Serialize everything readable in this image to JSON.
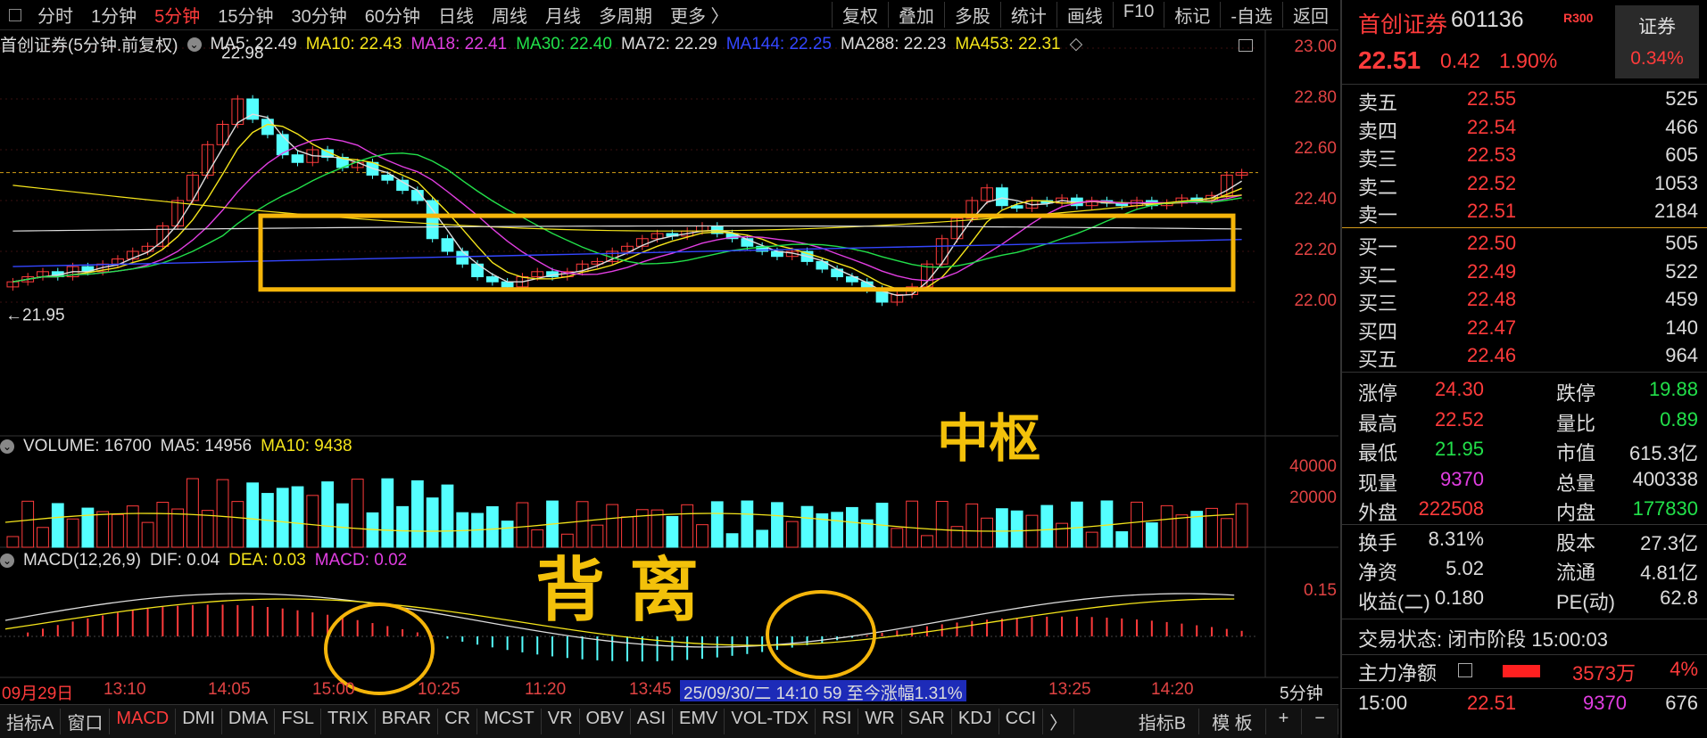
{
  "toolbar": {
    "periods": [
      "分时",
      "1分钟",
      "5分钟",
      "15分钟",
      "30分钟",
      "60分钟",
      "日线",
      "周线",
      "月线",
      "多周期",
      "更多 〉"
    ],
    "active_period": "5分钟",
    "tools": [
      "复权",
      "叠加",
      "多股",
      "统计",
      "画线",
      "F10",
      "标记",
      "-自选",
      "返回"
    ]
  },
  "main_legend": {
    "title": "首创证券(5分钟.前复权)",
    "items": [
      {
        "label": "MA5: 22.49",
        "color": "#dddddd"
      },
      {
        "label": "MA10: 22.43",
        "color": "#f5e51b"
      },
      {
        "label": "MA18: 22.41",
        "color": "#e13ee1"
      },
      {
        "label": "MA30: 22.40",
        "color": "#22e04a"
      },
      {
        "label": "MA72: 22.29",
        "color": "#dddddd"
      },
      {
        "label": "MA144: 22.25",
        "color": "#3446ff"
      },
      {
        "label": "MA288: 22.23",
        "color": "#dddddd"
      },
      {
        "label": "MA453: 22.31",
        "color": "#f5e51b"
      }
    ]
  },
  "price_axis": [
    "23.00",
    "22.80",
    "22.60",
    "22.40",
    "22.20",
    "22.00"
  ],
  "high_label": "22.98",
  "low_label": "21.95",
  "volume_legend": {
    "title": "VOLUME: 16700",
    "ma5": "MA5: 14956",
    "ma10": "MA10: 9438"
  },
  "volume_axis": [
    "40000",
    "20000"
  ],
  "macd_legend": {
    "title": "MACD(12,26,9)",
    "dif": "DIF: 0.04",
    "dea": "DEA: 0.03",
    "macd": "MACD: 0.02"
  },
  "macd_axis": [
    "0.15"
  ],
  "time_axis": [
    "09月29日",
    "13:10",
    "14:05",
    "15:00",
    "10:25",
    "11:20",
    "13:45",
    "13:25",
    "14:20"
  ],
  "time_highlight": "25/09/30/二 14:10 59 至今涨幅1.31%",
  "period_label": "5分钟",
  "annotations": {
    "zhongshu": "中枢",
    "beili": "背 离"
  },
  "tabs": [
    "指标A",
    "窗口",
    "MACD",
    "DMI",
    "DMA",
    "FSL",
    "TRIX",
    "BRAR",
    "CR",
    "MCST",
    "VR",
    "OBV",
    "ASI",
    "EMV",
    "VOL-TDX",
    "RSI",
    "WR",
    "SAR",
    "KDJ",
    "CCI",
    "〉"
  ],
  "active_tab": "MACD",
  "tabs_right": [
    "指标B",
    "模 板",
    "+",
    "−"
  ],
  "panel": {
    "name": "首创证券",
    "code": "601136",
    "badge": "R300",
    "sector": "证券",
    "sector_change": "0.34%",
    "price": "22.51",
    "change": "0.42",
    "change_pct": "1.90%",
    "asks": [
      {
        "label": "卖五",
        "price": "22.55",
        "vol": "525"
      },
      {
        "label": "卖四",
        "price": "22.54",
        "vol": "466"
      },
      {
        "label": "卖三",
        "price": "22.53",
        "vol": "605"
      },
      {
        "label": "卖二",
        "price": "22.52",
        "vol": "1053"
      },
      {
        "label": "卖一",
        "price": "22.51",
        "vol": "2184"
      }
    ],
    "bids": [
      {
        "label": "买一",
        "price": "22.50",
        "vol": "505"
      },
      {
        "label": "买二",
        "price": "22.49",
        "vol": "522"
      },
      {
        "label": "买三",
        "price": "22.48",
        "vol": "459"
      },
      {
        "label": "买四",
        "price": "22.47",
        "vol": "140"
      },
      {
        "label": "买五",
        "price": "22.46",
        "vol": "964"
      }
    ],
    "stats1": [
      {
        "l1": "涨停",
        "v1": "24.30",
        "c1": "red",
        "l2": "跌停",
        "v2": "19.88",
        "c2": "green"
      },
      {
        "l1": "最高",
        "v1": "22.52",
        "c1": "red",
        "l2": "量比",
        "v2": "0.89",
        "c2": "green"
      },
      {
        "l1": "最低",
        "v1": "21.95",
        "c1": "green",
        "l2": "市值",
        "v2": "615.3亿",
        "c2": "white"
      },
      {
        "l1": "现量",
        "v1": "9370",
        "c1": "magenta",
        "l2": "总量",
        "v2": "400338",
        "c2": "white"
      },
      {
        "l1": "外盘",
        "v1": "222508",
        "c1": "red",
        "l2": "内盘",
        "v2": "177830",
        "c2": "green"
      }
    ],
    "stats2": [
      {
        "l1": "换手",
        "v1": "8.31%",
        "l2": "股本",
        "v2": "27.3亿"
      },
      {
        "l1": "净资",
        "v1": "5.02",
        "l2": "流通",
        "v2": "4.81亿"
      },
      {
        "l1": "收益(二)",
        "v1": "0.180",
        "l2": "PE(动)",
        "v2": "62.8"
      }
    ],
    "status": "交易状态: 闭市阶段 15:00:03",
    "main_flow_label": "主力净额",
    "main_flow_value": "3573万",
    "main_flow_pct": "4%",
    "tick": {
      "time": "15:00",
      "price": "22.51",
      "vol": "9370",
      "num": "676"
    }
  }
}
